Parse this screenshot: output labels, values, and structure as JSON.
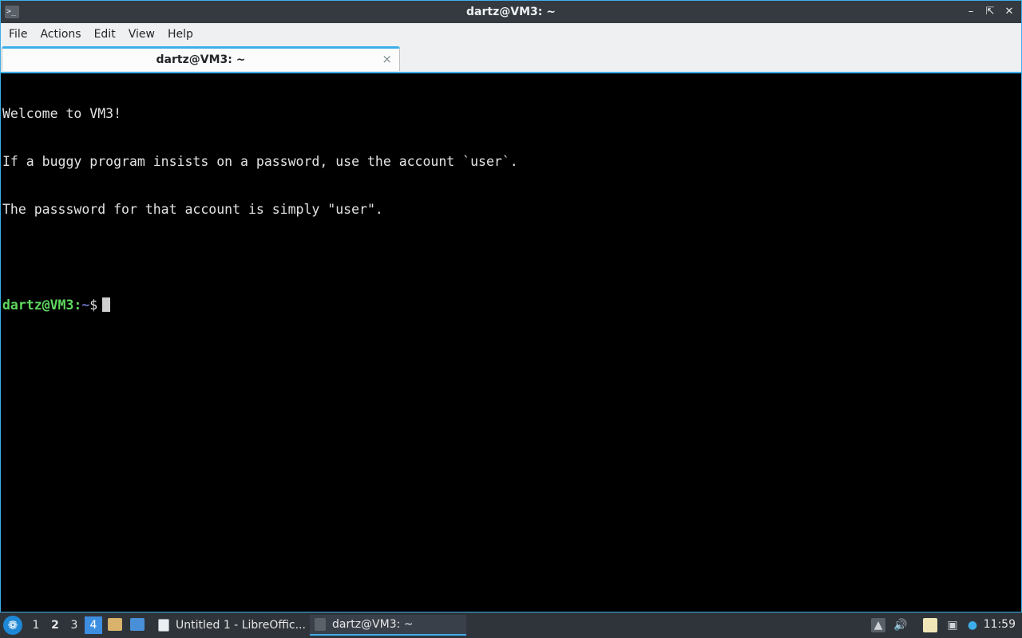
{
  "window": {
    "title": "dartz@VM3: ~",
    "controls": [
      "minimize-icon",
      "restore-icon",
      "close-icon"
    ]
  },
  "menubar": {
    "items": [
      "File",
      "Actions",
      "Edit",
      "View",
      "Help"
    ]
  },
  "tabs": [
    {
      "label": "dartz@VM3: ~",
      "close": "×"
    }
  ],
  "terminal": {
    "lines": [
      "Welcome to VM3!",
      "If a buggy program insists on a password, use the account `user`.",
      "The passsword for that account is simply \"user\".",
      ""
    ],
    "prompt": {
      "user_host": "dartz@VM3",
      "colon": ":",
      "path": "~",
      "symbol": "$"
    }
  },
  "taskbar": {
    "start_icon": "application-menu-icon",
    "workspaces": [
      "1",
      "2",
      "3",
      "4"
    ],
    "active_workspace": "4",
    "tasks": [
      {
        "label": "Untitled 1 - LibreOffic...",
        "icon": "writer-document-icon"
      },
      {
        "label": "dartz@VM3: ~",
        "icon": "terminal-icon"
      }
    ],
    "clock": "11:59"
  },
  "colors": {
    "accent": "#3daee9",
    "prompt_user": "#5fd75f",
    "prompt_path": "#6c71c4",
    "terminal_bg": "#000000"
  }
}
